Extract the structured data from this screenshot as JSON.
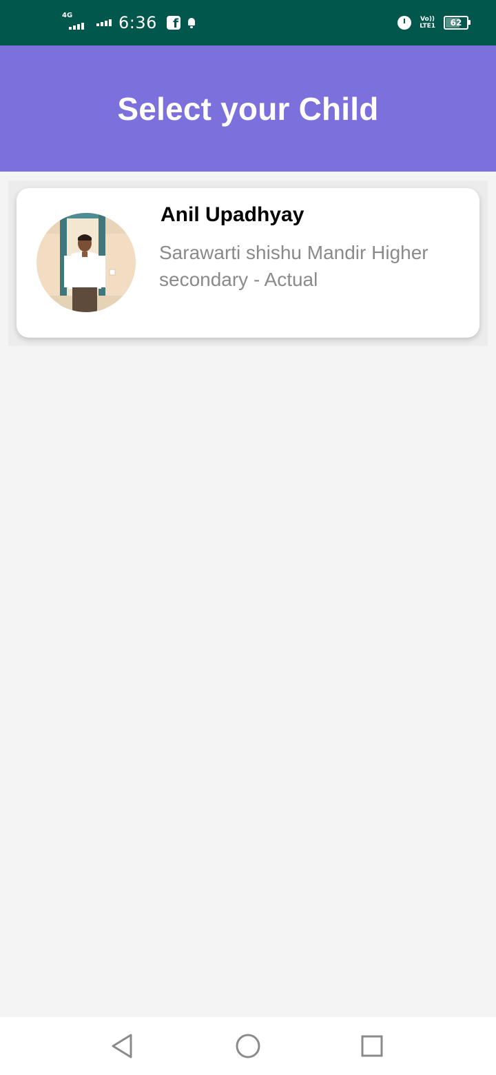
{
  "status_bar": {
    "network_label": "4G",
    "time": "6:36",
    "volte_line1": "Vo))",
    "volte_line2": "LTE1",
    "battery_level": "62",
    "battery_percent": 62,
    "icons": [
      "signal-icon",
      "facebook-icon",
      "notification-bell-icon",
      "alarm-icon",
      "volte-icon",
      "battery-icon"
    ]
  },
  "header": {
    "title": "Select your Child"
  },
  "children": [
    {
      "name": "Anil Upadhyay",
      "school": "Sarawarti shishu Mandir Higher secondary - Actual"
    }
  ],
  "nav_bar": {
    "icons": [
      "back-icon",
      "home-icon",
      "recents-icon"
    ]
  },
  "colors": {
    "status_bar": "#01574b",
    "header": "#7b70dc",
    "background": "#f4f4f4",
    "card": "#ffffff",
    "name_text": "#000000",
    "school_text": "#8a8a8a"
  }
}
